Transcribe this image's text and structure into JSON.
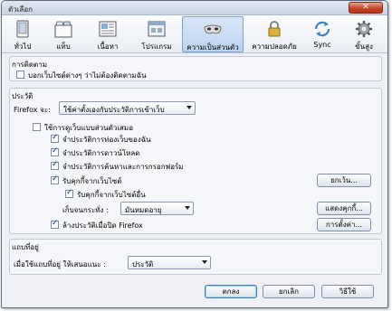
{
  "window": {
    "title": "ตัวเลือก",
    "close_label": "✕"
  },
  "toolbar": {
    "items": [
      {
        "label": "ทั่วไป",
        "icon": "switch-icon"
      },
      {
        "label": "แท็บ",
        "icon": "tabs-icon"
      },
      {
        "label": "เนื้อหา",
        "icon": "content-icon"
      },
      {
        "label": "โปรแกรม",
        "icon": "applications-icon"
      },
      {
        "label": "ความเป็นส่วนตัว",
        "icon": "mask-icon"
      },
      {
        "label": "ความปลอดภัย",
        "icon": "lock-icon"
      },
      {
        "label": "Sync",
        "icon": "sync-icon"
      },
      {
        "label": "ขั้นสูง",
        "icon": "gear-icon"
      }
    ],
    "selected": "ความเป็นส่วนตัว"
  },
  "tracking": {
    "title": "การติดตาม",
    "do_not_track": {
      "label": "บอกเว็บไซต์ต่างๆ ว่าไม่ต้องติดตามฉัน",
      "checked": false
    }
  },
  "history": {
    "title": "ประวัติ",
    "firefox_will_label": "Firefox จะ:",
    "mode_value": "ใช้ค่าตั้งเองกับประวัติการเข้าเว็บ",
    "private_mode": {
      "label": "ใช้การดูเว็บแบบส่วนตัวเสมอ",
      "checked": false
    },
    "remember_browsing": {
      "label": "จำประวัติการท่องเว็บของฉัน",
      "checked": true
    },
    "remember_downloads": {
      "label": "จำประวัติการดาวน์โหลด",
      "checked": true
    },
    "remember_search": {
      "label": "จำประวัติการค้นหาและการกรอกฟอร์ม",
      "checked": true
    },
    "accept_cookies": {
      "label": "รับคุกกี้จากเว็บไซต์",
      "checked": true
    },
    "third_party_cookies": {
      "label": "รับคุกกี้จากเว็บไซต์อื่น",
      "checked": true
    },
    "keep_until_label": "เก็บจนกระทั่ง :",
    "keep_until_value": "มันหมดอายุ",
    "clear_on_close": {
      "label": "ล้างประวัติเมื่อปิด Firefox",
      "checked": true
    },
    "exceptions_button": "ยกเว้น...",
    "show_cookies_button": "แสดงคุกกี้...",
    "settings_button": "การตั้งค่า..."
  },
  "location_bar": {
    "title": "แถบที่อยู่",
    "suggest_label": "เมื่อใช้แถบที่อยู่ ให้เสนอแนะ :",
    "suggest_value": "ประวัติ"
  },
  "footer": {
    "ok": "ตกลง",
    "cancel": "ยกเลิก",
    "help": "วิธีใช้"
  }
}
